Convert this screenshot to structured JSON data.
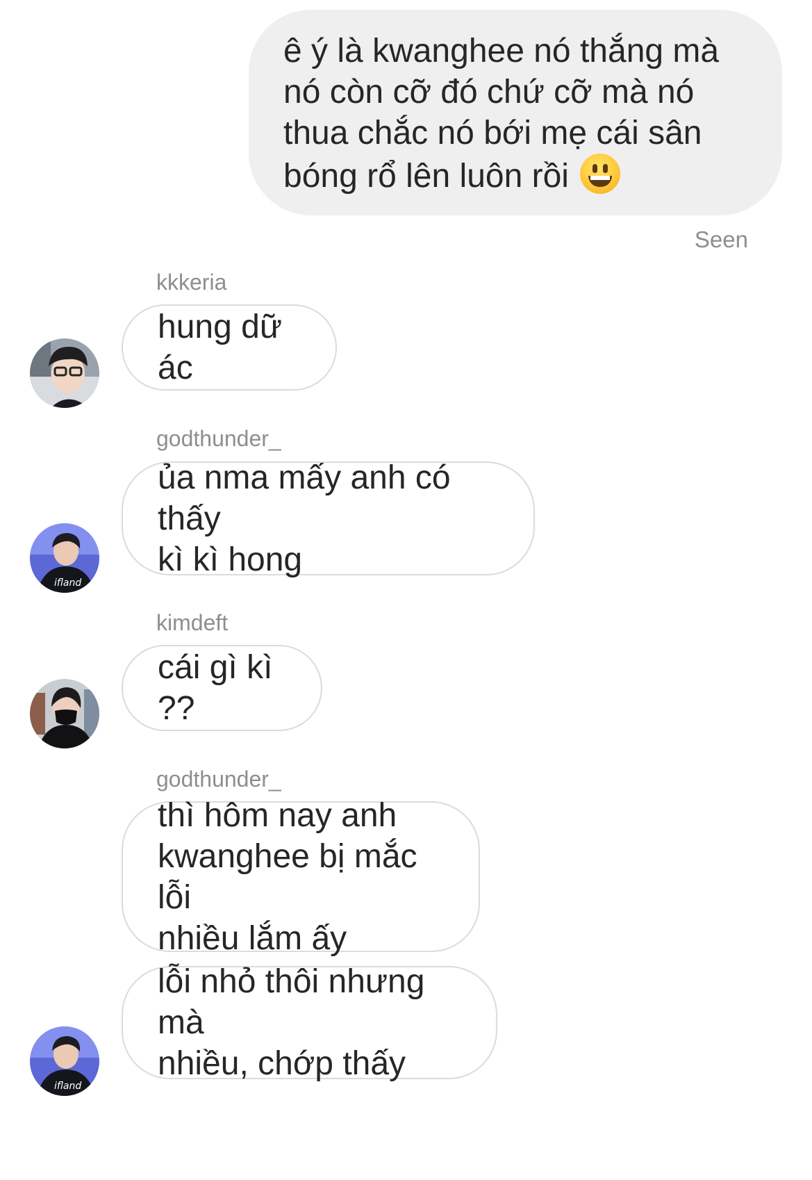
{
  "thread": {
    "sent_message": {
      "lines": [
        "ê ý là kwanghee nó thắng mà",
        "nó còn cỡ đó chứ cỡ mà nó",
        "thua chắc nó bới mẹ cái sân",
        "bóng rổ lên luôn rồi"
      ],
      "emoji": "grinning-face-emoji"
    },
    "seen_label": "Seen",
    "messages": [
      {
        "sender": "kkkeria",
        "avatar_icon": "avatar-glasses",
        "bubbles": [
          {
            "lines": [
              "hung dữ ác"
            ]
          }
        ]
      },
      {
        "sender": "godthunder_",
        "avatar_icon": "avatar-jersey",
        "bubbles": [
          {
            "lines": [
              "ủa nma mấy anh có thấy",
              "kì kì hong"
            ]
          }
        ]
      },
      {
        "sender": "kimdeft",
        "avatar_icon": "avatar-mask",
        "bubbles": [
          {
            "lines": [
              "cái gì kì ??"
            ]
          }
        ]
      },
      {
        "sender": "godthunder_",
        "avatar_icon": "avatar-jersey",
        "bubbles": [
          {
            "lines": [
              "thì hôm nay anh",
              "kwanghee bị mắc lỗi",
              "nhiều lắm ấy"
            ]
          },
          {
            "lines": [
              "lỗi nhỏ thôi nhưng mà",
              "nhiều, chớp thấy"
            ]
          }
        ]
      }
    ]
  }
}
